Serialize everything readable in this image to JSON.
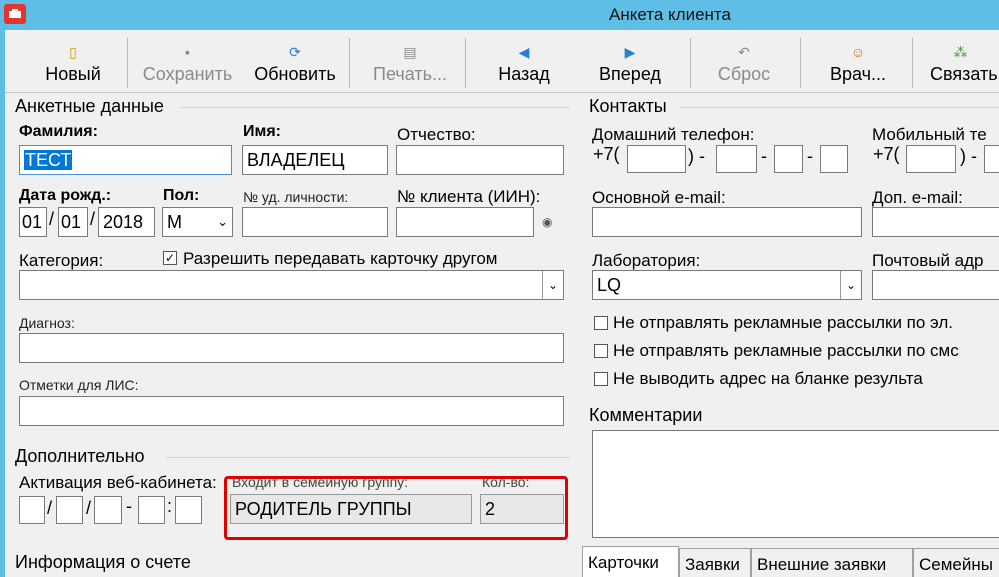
{
  "window": {
    "title": "Анкета клиента"
  },
  "toolbar": {
    "new": "Новый",
    "save": "Сохранить",
    "refresh": "Обновить",
    "print": "Печать...",
    "back": "Назад",
    "forward": "Вперед",
    "reset": "Сброс",
    "doctor": "Врач...",
    "link": "Связать"
  },
  "personal": {
    "title": "Анкетные данные",
    "surname_label": "Фамилия:",
    "surname_value": "ТЕСТ",
    "name_label": "Имя:",
    "name_value": "ВЛАДЕЛЕЦ",
    "patronymic_label": "Отчество:",
    "patronymic_value": "",
    "dob_label": "Дата рожд.:",
    "dob_day": "01",
    "dob_month": "01",
    "dob_year": "2018",
    "sex_label": "Пол:",
    "sex_value": "М",
    "id_label": "№ уд. личности:",
    "client_no_label": "№ клиента (ИИН):",
    "category_label": "Категория:",
    "allow_transfer_label": "Разрешить передавать карточку другом",
    "diagnosis_label": "Диагноз:",
    "lis_label": "Отметки для ЛИС:"
  },
  "additional": {
    "title": "Дополнительно",
    "web_label": "Активация веб-кабинета:",
    "family_label": "Входит в семейную группу:",
    "family_value": "РОДИТЕЛЬ ГРУППЫ",
    "count_label": "Кол-во:",
    "count_value": "2"
  },
  "account": {
    "title": "Информация о счете"
  },
  "contacts": {
    "title": "Контакты",
    "home_phone_label": "Домашний телефон:",
    "mobile_phone_label": "Мобильный те",
    "phone_prefix": "+7(",
    "email_label": "Основной e-mail:",
    "extra_email_label": "Доп. e-mail:",
    "lab_label": "Лаборатория:",
    "lab_value": "LQ",
    "postal_label": "Почтовый адр",
    "no_ads_email": "Не отправлять рекламные рассылки по эл.",
    "no_ads_sms": "Не отправлять рекламные рассылки по смс",
    "no_address": "Не выводить адрес на бланке результа"
  },
  "comments": {
    "title": "Комментарии"
  },
  "tabs": [
    "Карточки",
    "Заявки",
    "Внешние заявки",
    "Семейны"
  ]
}
